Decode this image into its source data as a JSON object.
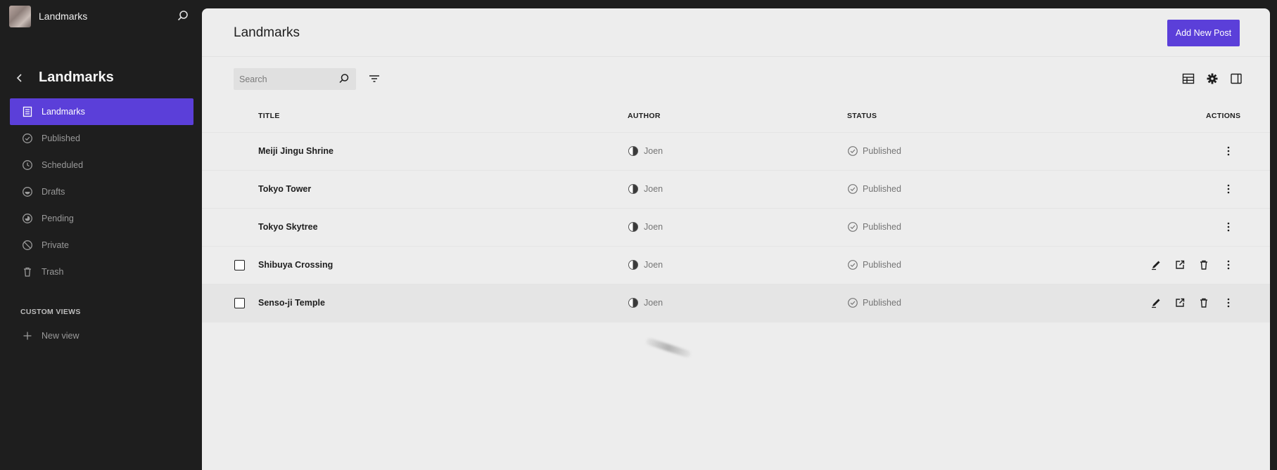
{
  "site": {
    "name": "Landmarks"
  },
  "sidebar": {
    "section_title": "Landmarks",
    "items": [
      {
        "label": "Landmarks",
        "icon": "pages-icon",
        "active": true
      },
      {
        "label": "Published",
        "icon": "published-icon",
        "active": false
      },
      {
        "label": "Scheduled",
        "icon": "scheduled-icon",
        "active": false
      },
      {
        "label": "Drafts",
        "icon": "drafts-icon",
        "active": false
      },
      {
        "label": "Pending",
        "icon": "pending-icon",
        "active": false
      },
      {
        "label": "Private",
        "icon": "private-icon",
        "active": false
      },
      {
        "label": "Trash",
        "icon": "trash-icon",
        "active": false
      }
    ],
    "custom_views_heading": "CUSTOM VIEWS",
    "new_view_label": "New view"
  },
  "main": {
    "title": "Landmarks",
    "add_button_label": "Add New Post",
    "search": {
      "placeholder": "Search",
      "value": ""
    },
    "columns": {
      "title": "TITLE",
      "author": "AUTHOR",
      "status": "STATUS",
      "actions": "ACTIONS"
    },
    "rows": [
      {
        "title": "Meiji Jingu Shrine",
        "author": "Joen",
        "status": "Published"
      },
      {
        "title": "Tokyo Tower",
        "author": "Joen",
        "status": "Published"
      },
      {
        "title": "Tokyo Skytree",
        "author": "Joen",
        "status": "Published"
      },
      {
        "title": "Shibuya Crossing",
        "author": "Joen",
        "status": "Published"
      },
      {
        "title": "Senso-ji Temple",
        "author": "Joen",
        "status": "Published"
      }
    ]
  },
  "colors": {
    "accent": "#5b3fd9",
    "sidebar_bg": "#1e1e1e",
    "panel_bg": "#ededed",
    "muted_text": "#757575"
  }
}
